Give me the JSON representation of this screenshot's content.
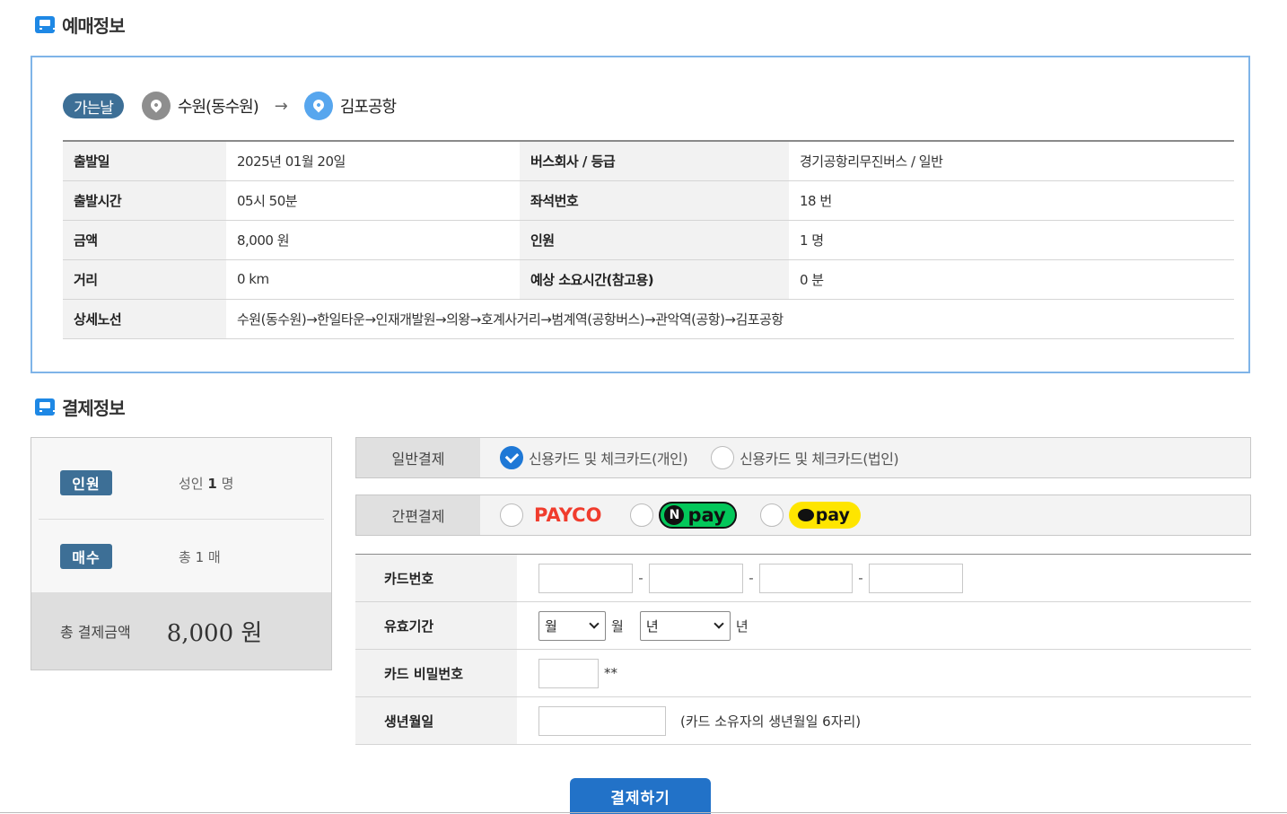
{
  "reservation": {
    "section_title": "예매정보",
    "direction_badge": "가는날",
    "origin": "수원(동수원)",
    "arrow": "→",
    "destination": "김포공항",
    "rows": [
      {
        "label1": "출발일",
        "value1": "2025년 01월 20일",
        "label2": "버스회사 / 등급",
        "value2": "경기공항리무진버스 / 일반"
      },
      {
        "label1": "출발시간",
        "value1": "05시 50분",
        "label2": "좌석번호",
        "value2": "18 번"
      },
      {
        "label1": "금액",
        "value1": "8,000 원",
        "label2": "인원",
        "value2": "1 명"
      },
      {
        "label1": "거리",
        "value1": "0 km",
        "label2": "예상 소요시간(참고용)",
        "value2": "0 분"
      }
    ],
    "route_label": "상세노선",
    "route_value": "수원(동수원)→한일타운→인재개발원→의왕→호계사거리→범계역(공항버스)→관악역(공항)→김포공항"
  },
  "payment": {
    "section_title": "결제정보",
    "summary": {
      "people_badge": "인원",
      "people_prefix": "성인",
      "people_count": "1",
      "people_unit": "명",
      "tickets_badge": "매수",
      "tickets_prefix": "총",
      "tickets_count": "1",
      "tickets_unit": "매",
      "total_label": "총 결제금액",
      "total_value": "8,000 원"
    },
    "general": {
      "label": "일반결제",
      "option_personal": "신용카드 및 체크카드(개인)",
      "option_corporate": "신용카드 및 체크카드(법인)",
      "selected": "personal"
    },
    "easy": {
      "label": "간편결제",
      "payco": "PAYCO",
      "npay_n": "N",
      "npay": "pay",
      "kakaopay": "pay"
    },
    "card_form": {
      "card_number_label": "카드번호",
      "card_sep": "-",
      "expiry_label": "유효기간",
      "month_select": "월",
      "month_unit": "월",
      "year_select": "년",
      "year_unit": "년",
      "password_label": "카드 비밀번호",
      "password_suffix": "**",
      "birth_label": "생년월일",
      "birth_hint": "(카드 소유자의 생년월일 6자리)"
    },
    "submit_label": "결제하기"
  },
  "colors": {
    "accent": "#2272c8",
    "badge": "#3d6f96",
    "box_border": "#7fb4e8",
    "npay_green": "#03c75a",
    "kakao_yellow": "#fee500",
    "payco_red": "#f03c2d"
  }
}
